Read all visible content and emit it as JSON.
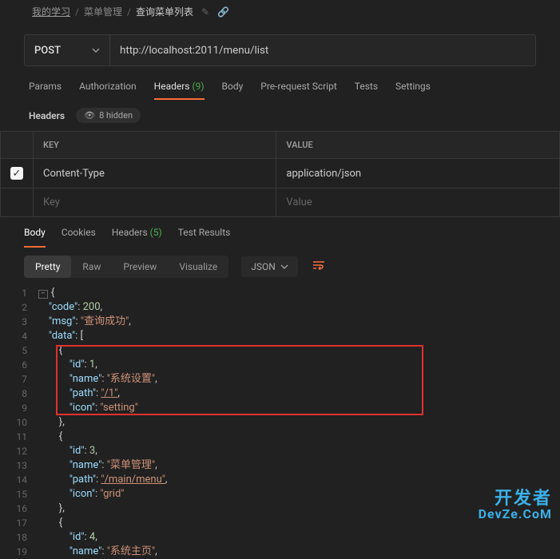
{
  "breadcrumb": {
    "root": "我的学习",
    "mid": "菜单管理",
    "current": "查询菜单列表"
  },
  "request": {
    "method": "POST",
    "url": "http://localhost:2011/menu/list"
  },
  "tabs": {
    "params": "Params",
    "auth": "Authorization",
    "headers": "Headers",
    "headers_count": "(9)",
    "body": "Body",
    "prereq": "Pre-request Script",
    "tests": "Tests",
    "settings": "Settings"
  },
  "headers_sub": {
    "label": "Headers",
    "hidden": "8 hidden"
  },
  "table": {
    "col_key": "KEY",
    "col_value": "VALUE",
    "row_key": "Content-Type",
    "row_value": "application/json",
    "ph_key": "Key",
    "ph_value": "Value"
  },
  "resp_tabs": {
    "body": "Body",
    "cookies": "Cookies",
    "headers": "Headers",
    "headers_count": "(5)",
    "results": "Test Results"
  },
  "fmt": {
    "pretty": "Pretty",
    "raw": "Raw",
    "preview": "Preview",
    "visualize": "Visualize",
    "lang": "JSON"
  },
  "watermark": {
    "l1": "开发者",
    "l2": "DevZe.CoM"
  },
  "chart_data": {
    "type": "table",
    "title": "JSON response body",
    "response": {
      "code": 200,
      "msg": "查询成功",
      "data": [
        {
          "id": 1,
          "name": "系统设置",
          "path": "/1",
          "icon": "setting"
        },
        {
          "id": 3,
          "name": "菜单管理",
          "path": "/main/menu",
          "icon": "grid"
        },
        {
          "id": 4,
          "name": "系统主页"
        }
      ]
    },
    "lines": [
      {
        "n": 1,
        "t": "{"
      },
      {
        "n": 2,
        "t": "    \"code\": 200,"
      },
      {
        "n": 3,
        "t": "    \"msg\": \"查询成功\","
      },
      {
        "n": 4,
        "t": "    \"data\": ["
      },
      {
        "n": 5,
        "t": "        {"
      },
      {
        "n": 6,
        "t": "            \"id\": 1,"
      },
      {
        "n": 7,
        "t": "            \"name\": \"系统设置\","
      },
      {
        "n": 8,
        "t": "            \"path\": \"/1\","
      },
      {
        "n": 9,
        "t": "            \"icon\": \"setting\""
      },
      {
        "n": 10,
        "t": "        },"
      },
      {
        "n": 11,
        "t": "        {"
      },
      {
        "n": 12,
        "t": "            \"id\": 3,"
      },
      {
        "n": 13,
        "t": "            \"name\": \"菜单管理\","
      },
      {
        "n": 14,
        "t": "            \"path\": \"/main/menu\","
      },
      {
        "n": 15,
        "t": "            \"icon\": \"grid\""
      },
      {
        "n": 16,
        "t": "        },"
      },
      {
        "n": 17,
        "t": "        {"
      },
      {
        "n": 18,
        "t": "            \"id\": 4,"
      },
      {
        "n": 19,
        "t": "            \"name\": \"系统主页\","
      }
    ]
  }
}
